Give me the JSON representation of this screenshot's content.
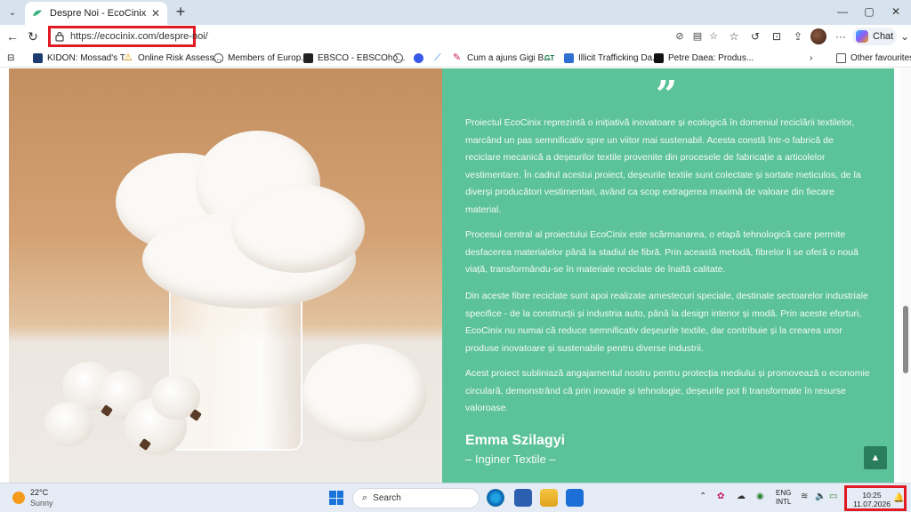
{
  "browser": {
    "tab_title": "Despre Noi - EcoCinix",
    "url": "https://ecocinix.com/despre-noi/",
    "chat_label": "Chat",
    "new_tab_symbol": "+",
    "tab_close_symbol": "✕",
    "min_symbol": "—",
    "max_symbol": "▢",
    "close_symbol": "✕",
    "more_symbol": "···"
  },
  "bookmarks": {
    "items": [
      {
        "label": "KIDON: Mossad's T...",
        "icon": "kidon-icon",
        "color": "#1c3b6e"
      },
      {
        "label": "Online Risk Assess...",
        "icon": "warning-icon",
        "color": "#f2a000"
      },
      {
        "label": "Members of Europ...",
        "icon": "globe-icon",
        "color": "#555555"
      },
      {
        "label": "EBSCO - EBSCOho...",
        "icon": "ebsco-icon",
        "color": "#222222"
      },
      {
        "label": "",
        "icon": "globe-icon",
        "color": "#555555"
      },
      {
        "label": "",
        "icon": "wordpress-icon",
        "color": "#3858e9"
      },
      {
        "label": "",
        "icon": "feather-icon",
        "color": "#1a73e8"
      },
      {
        "label": "Cum a ajuns Gigi B...",
        "icon": "pen-icon",
        "color": "#c2185b"
      },
      {
        "label": "",
        "icon": "gt-icon",
        "color": "#0a7a3b"
      },
      {
        "label": "Illicit Trafficking Da...",
        "icon": "doc-icon",
        "color": "#2f6fd1"
      },
      {
        "label": "Petre Daea: Produs...",
        "icon": "c-icon",
        "color": "#111111"
      }
    ],
    "other_favourites": "Other favourites"
  },
  "content": {
    "quote_mark": "”",
    "paragraphs": [
      "Proiectul EcoCinix reprezintă o inițiativă inovatoare și ecologică în domeniul reciclării textilelor, marcând un pas semnificativ spre un viitor mai sustenabil. Acesta constă într-o fabrică de reciclare mecanică a deșeurilor textile provenite din procesele de fabricație a articolelor vestimentare. În cadrul acestui proiect, deșeurile textile sunt colectate și sortate meticulos, de la diverși producători vestimentari, având ca scop extragerea maximă de valoare din fiecare material.",
      "Procesul central al proiectului EcoCinix este scărmanarea, o etapă tehnologică care permite desfacerea materialelor până la stadiul de fibră. Prin această metodă, fibrelor li se oferă o nouă viață, transformându-se în materiale reciclate de înaltă calitate.",
      "Din aceste fibre reciclate sunt apoi realizate amestecuri speciale, destinate sectoarelor industriale specifice - de la construcții și industria auto, până la design interior și modă. Prin aceste eforturi, EcoCinix nu numai că reduce semnificativ deșeurile textile, dar contribuie și la crearea unor produse inovatoare și sustenabile pentru diverse industrii.",
      "Acest proiect subliniază angajamentul nostru pentru protecția mediului și promovează o economie circulară, demonstrând că prin inovație și tehnologie, deșeurile pot fi transformate în resurse valoroase."
    ],
    "author_name": "Emma Szilagyi",
    "author_role": "– Inginer Textile –",
    "back_to_top": "▲",
    "accent_color": "#5cc29a"
  },
  "taskbar": {
    "temperature": "22°C",
    "weather": "Sunny",
    "search_placeholder": "Search",
    "lang_top": "ENG",
    "lang_bottom": "INTL",
    "time": "10:25",
    "date": "11.07.2026"
  }
}
